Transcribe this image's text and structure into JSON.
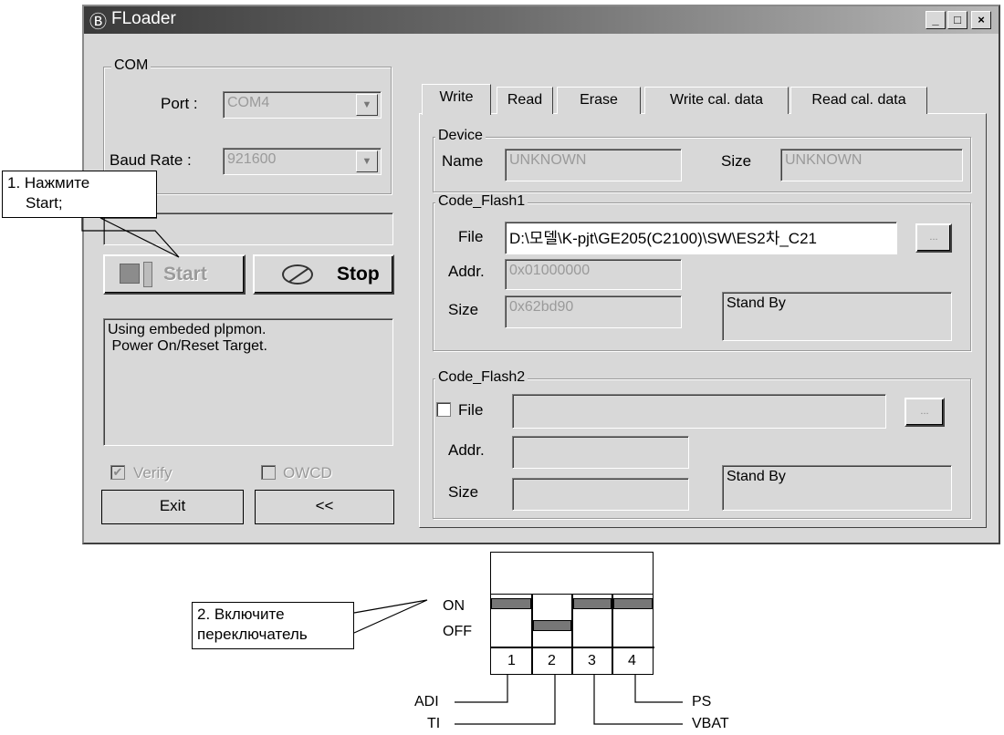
{
  "window": {
    "title": "FLoader",
    "controls": [
      "_",
      "□",
      "×"
    ]
  },
  "com": {
    "group_label": "COM",
    "port_label": "Port :",
    "port_value": "COM4",
    "baud_label": "Baud Rate :",
    "baud_value": "921600"
  },
  "buttons": {
    "start": "Start",
    "stop": "Stop",
    "exit": "Exit",
    "collapse": "<<"
  },
  "log": {
    "line1": "Using embeded plpmon.",
    "line2": " Power On/Reset Target."
  },
  "options": {
    "verify_label": "Verify",
    "verify_checked": true,
    "owcd_label": "OWCD",
    "owcd_checked": false
  },
  "tabs": [
    "Write",
    "Read",
    "Erase",
    "Write cal. data",
    "Read cal. data"
  ],
  "active_tab": "Write",
  "device": {
    "group_label": "Device",
    "name_label": "Name",
    "name_value": "UNKNOWN",
    "size_label": "Size",
    "size_value": "UNKNOWN"
  },
  "flash1": {
    "group_label": "Code_Flash1",
    "file_label": "File",
    "file_value": "D:\\모델\\K-pjt\\GE205(C2100)\\SW\\ES2차_C21",
    "browse_label": "...",
    "addr_label": "Addr.",
    "addr_value": "0x01000000",
    "size_label": "Size",
    "size_value": "0x62bd90",
    "status": "Stand By"
  },
  "flash2": {
    "group_label": "Code_Flash2",
    "file_label": "File",
    "file_checked": false,
    "file_value": "",
    "browse_label": "...",
    "addr_label": "Addr.",
    "addr_value": "",
    "size_label": "Size",
    "size_value": "",
    "status": "Stand By"
  },
  "annotations": {
    "step1_line1": "1. Нажмите",
    "step1_line2": "Start;",
    "step2_line1": "2. Включите",
    "step2_line2": "переключатель"
  },
  "dip_switch": {
    "on_label": "ON",
    "off_label": "OFF",
    "numbers": [
      "1",
      "2",
      "3",
      "4"
    ],
    "states": [
      "ON",
      "OFF",
      "ON",
      "ON"
    ],
    "signal_labels": [
      "ADI",
      "TI",
      "VBAT",
      "PS"
    ]
  }
}
